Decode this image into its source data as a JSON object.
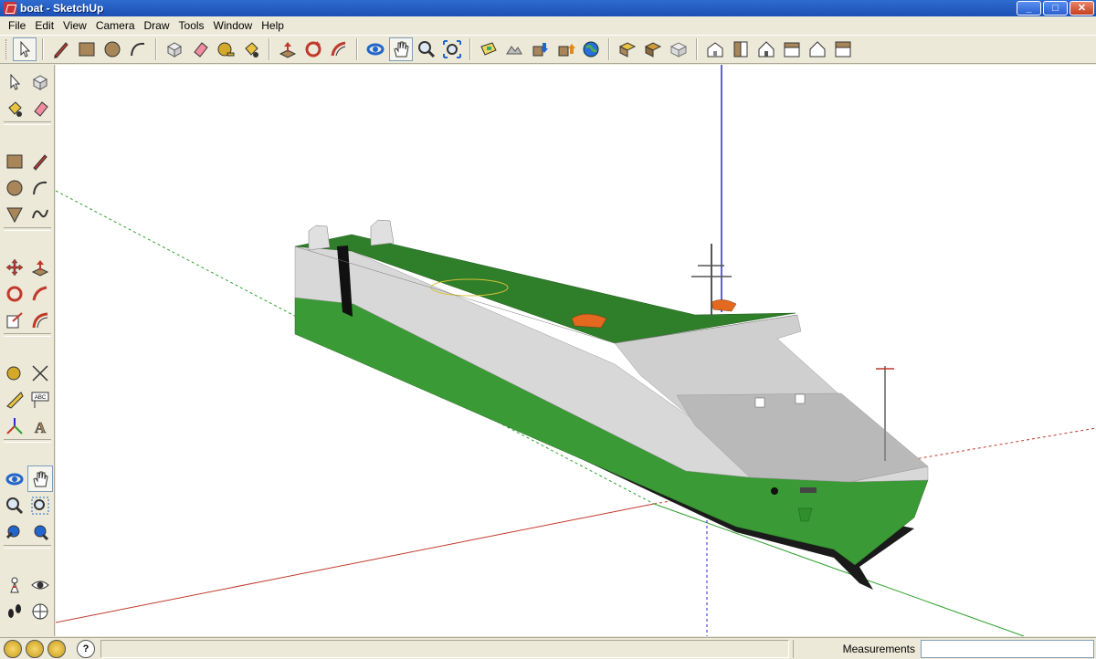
{
  "window": {
    "title": "boat - SketchUp",
    "controls": {
      "minimize": "_",
      "maximize": "□",
      "close": "✕"
    }
  },
  "menu": [
    "File",
    "Edit",
    "View",
    "Camera",
    "Draw",
    "Tools",
    "Window",
    "Help"
  ],
  "top_toolbar": [
    "select",
    "pencil",
    "rectangle",
    "circle",
    "arc",
    "make-component",
    "eraser",
    "tape-measure",
    "paint-bucket",
    "push-pull",
    "rotate",
    "follow-me",
    "orbit",
    "pan",
    "zoom",
    "zoom-extents",
    "add-location",
    "toggle-terrain",
    "get-models",
    "share-model",
    "google-earth",
    "get-photo-texture",
    "share-component",
    "styles",
    "iso-view",
    "top-view",
    "front-view",
    "right-view",
    "back-view",
    "left-view"
  ],
  "left_toolbar": [
    "select",
    "make-component",
    "paint-bucket",
    "eraser",
    "rectangle",
    "pencil",
    "circle",
    "arc",
    "polygon",
    "freehand",
    "move",
    "push-pull",
    "rotate",
    "follow-me",
    "scale",
    "offset",
    "tape-measure",
    "dimension",
    "protractor",
    "text",
    "axes",
    "3d-text",
    "orbit",
    "pan",
    "zoom",
    "zoom-window",
    "previous",
    "zoom-extents",
    "position-camera",
    "look-around",
    "walk",
    "section-plane"
  ],
  "left_toolbar_text": {
    "text_tool": "ABC",
    "three_d_text": "A"
  },
  "status": {
    "help_icon": "?",
    "measurements_label": "Measurements",
    "measurements_value": ""
  },
  "colors": {
    "hull_green": "#3a9a35",
    "deck_green": "#2f7e29",
    "superstructure": "#d9d9d9",
    "axis_red": "#c0392b",
    "axis_green": "#2ea02e",
    "axis_blue": "#2b2bd0"
  }
}
